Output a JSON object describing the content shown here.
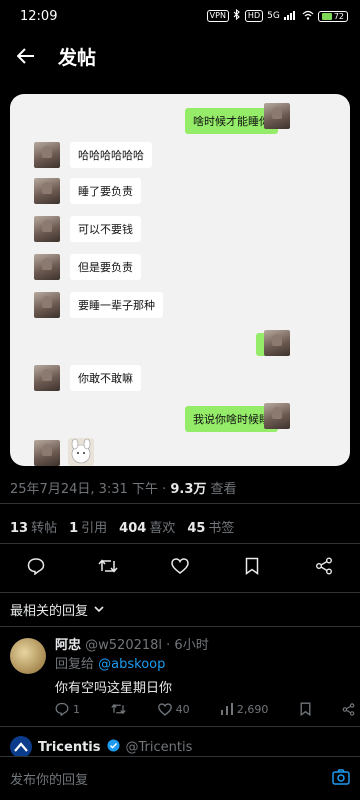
{
  "status_bar": {
    "time": "12:09",
    "vpn": "VPN",
    "hd": "HD",
    "network": "5G",
    "battery": "72"
  },
  "header": {
    "title": "发帖"
  },
  "chat": {
    "messages": [
      {
        "side": "right",
        "text": "啥时候才能睡你"
      },
      {
        "side": "left",
        "text": "哈哈哈哈哈哈"
      },
      {
        "side": "left",
        "text": "睡了要负责"
      },
      {
        "side": "left",
        "text": "可以不要钱"
      },
      {
        "side": "left",
        "text": "但是要负责"
      },
      {
        "side": "left",
        "text": "要睡一辈子那种"
      },
      {
        "side": "right",
        "text": "?"
      },
      {
        "side": "left",
        "text": "你敢不敢嘛"
      },
      {
        "side": "right",
        "text": "我说你啥时候睡"
      }
    ]
  },
  "post_meta": {
    "date": "25年7月24日, 3:31 下午 · ",
    "views": "9.3万",
    "views_label": " 查看"
  },
  "stats": {
    "reposts": "13",
    "reposts_label": "转帖",
    "quotes": "1",
    "quotes_label": "引用",
    "likes": "404",
    "likes_label": "喜欢",
    "bookmarks": "45",
    "bookmarks_label": "书签"
  },
  "sort": {
    "label": "最相关的回复"
  },
  "reply": {
    "name": "阿忠",
    "handle": "@w520218l",
    "time": " · 6小时",
    "reply_to_label": "回复给 ",
    "reply_to": "@abskoop",
    "text": "你有空吗这星期日你",
    "comments": "1",
    "likes": "40",
    "views": "2,690"
  },
  "next_reply": {
    "name": "Tricentis",
    "handle": "@Tricentis"
  },
  "compose": {
    "placeholder": "发布你的回复"
  },
  "colors": {
    "accent": "#1d9bf0",
    "wechat_green": "#95ec69",
    "muted": "#71767b"
  }
}
